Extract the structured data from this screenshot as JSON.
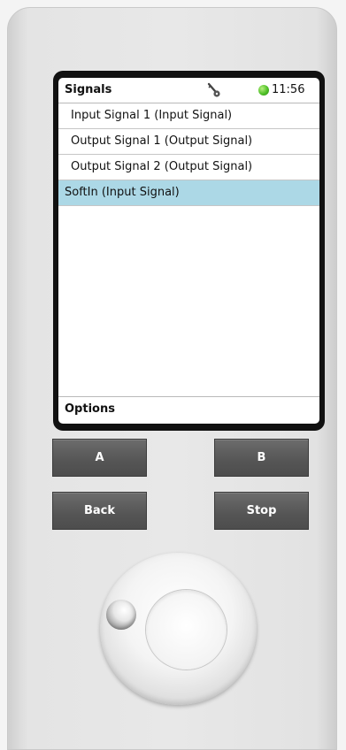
{
  "screen": {
    "title": "Signals",
    "time": "11:56",
    "status_color": "#4fc028",
    "icons": {
      "status_icon": "key-icon",
      "indicator": "green-status-dot"
    },
    "signals": [
      {
        "label": "Input Signal 1 (Input Signal)",
        "selected": false
      },
      {
        "label": "Output Signal 1 (Output Signal)",
        "selected": false
      },
      {
        "label": "Output Signal 2 (Output Signal)",
        "selected": false
      },
      {
        "label": "SoftIn (Input Signal)",
        "selected": true
      }
    ],
    "selection_color": "#acd8e6",
    "options_label": "Options"
  },
  "buttons": {
    "a": "A",
    "b": "B",
    "back": "Back",
    "stop": "Stop"
  }
}
